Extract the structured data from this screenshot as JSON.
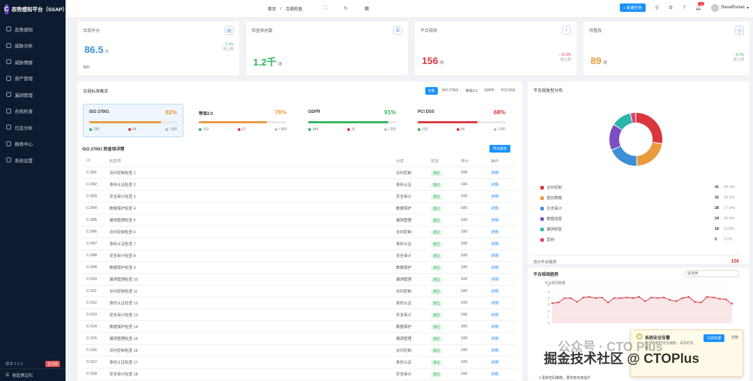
{
  "app": {
    "title": "态势感知平台（SSAP）",
    "badge": "企业版"
  },
  "sidebar": {
    "items": [
      {
        "label": "态势感知"
      },
      {
        "label": "威胁分析"
      },
      {
        "label": "威胁情报"
      },
      {
        "label": "资产管理"
      },
      {
        "label": "漏洞管理"
      },
      {
        "label": "合规检查"
      },
      {
        "label": "日志分析"
      },
      {
        "label": "报表中心"
      },
      {
        "label": "系统设置"
      }
    ],
    "version": "版本 2.1.0",
    "version_badge": "企业版",
    "collapse_label": "收起侧边栏"
  },
  "header": {
    "breadcrumb_home": "首页",
    "breadcrumb_current": "合规检查",
    "new_task": "+ 新建任务",
    "notification_count": "12",
    "user": "SteveRocket"
  },
  "kpis": [
    {
      "title": "合规评分",
      "value": "86.5",
      "unit": "分",
      "trend": "↑ 5.2%",
      "trend_note": "较上周",
      "sub": "良好",
      "color": "#3d8fd6"
    },
    {
      "title": "检查项总数",
      "value": "1.2千",
      "unit": "项",
      "trend": "",
      "trend_note": "",
      "sub": "",
      "color": "#2db55d"
    },
    {
      "title": "不合规项",
      "value": "156",
      "unit": "项",
      "trend": "↓ 12.3%",
      "trend_note": "较上周",
      "sub": "",
      "color": "#d9363e"
    },
    {
      "title": "待整改",
      "value": "89",
      "unit": "项",
      "trend": "↓ 8.1%",
      "trend_note": "较上周",
      "sub": "",
      "color": "#e89a3c"
    }
  ],
  "compliance": {
    "title": "合规标准概览",
    "tabs": [
      "全部",
      "ISO 27001",
      "等保2.0",
      "GDPR",
      "PCI DSS"
    ],
    "standards": [
      {
        "name": "ISO 27001",
        "pct": "82%",
        "pct_value": 82,
        "color": "#e89a3c",
        "bar_color": "#e89a3c",
        "pass": "235",
        "fail": "54",
        "total": "/ 300"
      },
      {
        "name": "等保2.0",
        "pct": "78%",
        "pct_value": 78,
        "color": "#e89a3c",
        "bar_color": "#e89a3c",
        "pass": "213",
        "fail": "67",
        "total": "/ 300"
      },
      {
        "name": "GDPR",
        "pct": "91%",
        "pct_value": 91,
        "color": "#2db55d",
        "bar_color": "#2db55d",
        "pass": "184",
        "fail": "16",
        "total": "/ 200"
      },
      {
        "name": "PCI DSS",
        "pct": "68%",
        "pct_value": 68,
        "color": "#d9363e",
        "bar_color": "#d9363e",
        "pass": "136",
        "fail": "64",
        "total": "/ 200"
      }
    ]
  },
  "details": {
    "title": "ISO 27001 检查项详情",
    "export": "导出报告",
    "columns": [
      "ID",
      "检查项",
      "分类",
      "状态",
      "得分",
      "操作"
    ],
    "rows": [
      {
        "id": "C-001",
        "name": "访问控制检查 1",
        "cat": "访问控制",
        "status": "通过",
        "score": "100",
        "op": "详情"
      },
      {
        "id": "C-002",
        "name": "身份认证检查 2",
        "cat": "身份认证",
        "status": "通过",
        "score": "100",
        "op": "详情"
      },
      {
        "id": "C-003",
        "name": "安全审计检查 3",
        "cat": "安全审计",
        "status": "通过",
        "score": "100",
        "op": "详情"
      },
      {
        "id": "C-004",
        "name": "数据保护检查 4",
        "cat": "数据保护",
        "status": "通过",
        "score": "100",
        "op": "详情"
      },
      {
        "id": "C-005",
        "name": "漏洞管理检查 5",
        "cat": "漏洞管理",
        "status": "通过",
        "score": "100",
        "op": "详情"
      },
      {
        "id": "C-006",
        "name": "访问控制检查 6",
        "cat": "访问控制",
        "status": "通过",
        "score": "100",
        "op": "详情"
      },
      {
        "id": "C-007",
        "name": "身份认证检查 7",
        "cat": "身份认证",
        "status": "通过",
        "score": "100",
        "op": "详情"
      },
      {
        "id": "C-008",
        "name": "安全审计检查 8",
        "cat": "安全审计",
        "status": "通过",
        "score": "100",
        "op": "详情"
      },
      {
        "id": "C-009",
        "name": "数据保护检查 9",
        "cat": "数据保护",
        "status": "通过",
        "score": "100",
        "op": "详情"
      },
      {
        "id": "C-010",
        "name": "漏洞管理检查 10",
        "cat": "漏洞管理",
        "status": "通过",
        "score": "100",
        "op": "详情"
      },
      {
        "id": "C-011",
        "name": "访问控制检查 11",
        "cat": "访问控制",
        "status": "通过",
        "score": "100",
        "op": "详情"
      },
      {
        "id": "C-012",
        "name": "身份认证检查 12",
        "cat": "身份认证",
        "status": "通过",
        "score": "100",
        "op": "详情"
      },
      {
        "id": "C-013",
        "name": "安全审计检查 13",
        "cat": "安全审计",
        "status": "通过",
        "score": "100",
        "op": "详情"
      },
      {
        "id": "C-014",
        "name": "数据保护检查 14",
        "cat": "数据保护",
        "status": "通过",
        "score": "100",
        "op": "详情"
      },
      {
        "id": "C-015",
        "name": "漏洞管理检查 15",
        "cat": "漏洞管理",
        "status": "通过",
        "score": "100",
        "op": "详情"
      },
      {
        "id": "C-016",
        "name": "访问控制检查 16",
        "cat": "访问控制",
        "status": "通过",
        "score": "100",
        "op": "详情"
      },
      {
        "id": "C-017",
        "name": "身份认证检查 17",
        "cat": "身份认证",
        "status": "通过",
        "score": "100",
        "op": "详情"
      },
      {
        "id": "C-018",
        "name": "安全审计检查 18",
        "cat": "安全审计",
        "status": "通过",
        "score": "100",
        "op": "详情"
      }
    ]
  },
  "distribution": {
    "title": "不合规类型分布",
    "items": [
      {
        "label": "访问控制",
        "count": "41",
        "pct": "26.3%",
        "color": "#d9363e"
      },
      {
        "label": "密码策略",
        "count": "32",
        "pct": "20.5%",
        "color": "#e89a3c"
      },
      {
        "label": "日志审计",
        "count": "28",
        "pct": "17.9%",
        "color": "#3d8fd6"
      },
      {
        "label": "数据加密",
        "count": "24",
        "pct": "15.4%",
        "color": "#7b4fc4"
      },
      {
        "label": "漏洞修复",
        "count": "18",
        "pct": "11.5%",
        "color": "#2bb5a8"
      },
      {
        "label": "其他",
        "count": "5",
        "pct": "3.2%",
        "color": "#d9467a"
      }
    ],
    "total_label": "总计不合规项",
    "total": "156"
  },
  "trend": {
    "title": "不合规项趋势",
    "range": "近30天",
    "series_label": "不合规项数量"
  },
  "chart_data": {
    "type": "line",
    "series": [
      {
        "name": "不合规项数量",
        "values": [
          3.2,
          3.3,
          4.0,
          4.0,
          3.4,
          4.1,
          4.2,
          4.0,
          4.1,
          3.3,
          4.0,
          4.0,
          4.1,
          4.0,
          4.2,
          3.5,
          4.1,
          4.0,
          4.1,
          3.7,
          3.5,
          4.0,
          4.2,
          3.4,
          3.3,
          4.2,
          4.1,
          3.9,
          3.8,
          3.1
        ]
      }
    ],
    "ylim": [
      0,
      6
    ],
    "yticks": [
      "6",
      "5",
      "4",
      "3",
      "2",
      "1",
      "0"
    ],
    "color": "#d9363e"
  },
  "popup": {
    "title": "系统安全告警",
    "body": "检测到新的安全威胁，请及时处理",
    "action": "立即处理",
    "close": "忽略"
  },
  "notice": "2  更新密码策略，要求复杂度提升",
  "watermark": "掘金技术社区 @ CTOPlus",
  "watermark2": "公众号 · CTO Plus"
}
